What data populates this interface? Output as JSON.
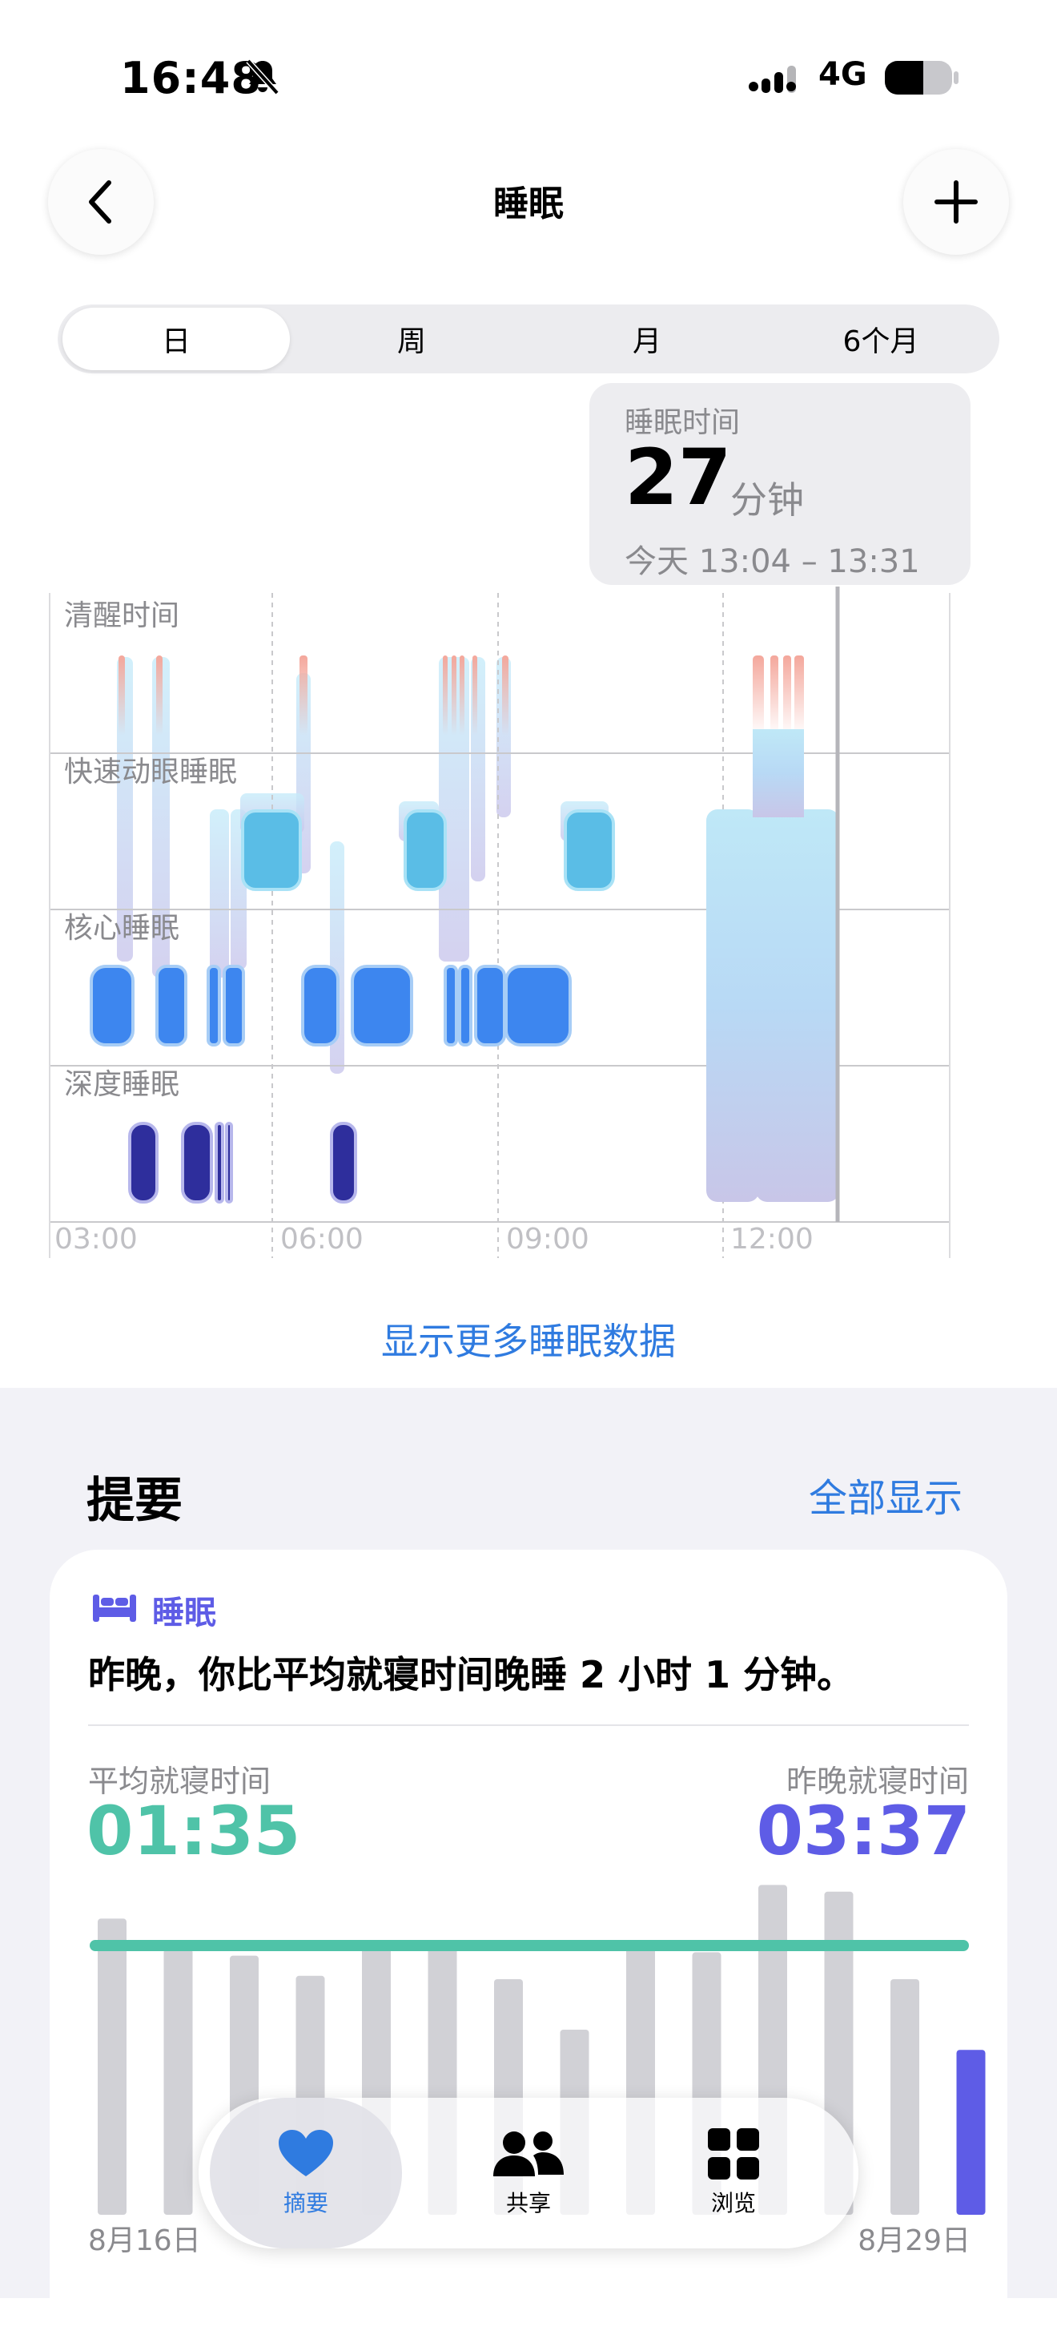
{
  "status_bar": {
    "time": "16:48",
    "network": "4G"
  },
  "nav": {
    "title": "睡眠"
  },
  "segments": [
    {
      "label": "日",
      "active": true
    },
    {
      "label": "周",
      "active": false
    },
    {
      "label": "月",
      "active": false
    },
    {
      "label": "6个月",
      "active": false
    }
  ],
  "popover": {
    "label": "睡眠时间",
    "value": "27",
    "unit": "分钟",
    "range": "今天 13:04 – 13:31"
  },
  "sleep_chart": {
    "stages": [
      "清醒时间",
      "快速动眼睡眠",
      "核心睡眠",
      "深度睡眠"
    ],
    "time_labels": [
      "03:00",
      "06:00",
      "09:00",
      "12:00"
    ],
    "colors": {
      "awake": "#f08a7a",
      "rem": "#5ac8fa",
      "core": "#3b82f6",
      "deep": "#2e2a9a"
    }
  },
  "more_link": "显示更多睡眠数据",
  "summary": {
    "title": "提要",
    "show_all": "全部显示"
  },
  "card": {
    "category": "睡眠",
    "headline": "昨晚，你比平均就寝时间晚睡 2 小时 1 分钟。",
    "avg_label": "平均就寝时间",
    "avg_value": "01:35",
    "last_label": "昨晚就寝时间",
    "last_value": "03:37",
    "start_date": "8月16日",
    "end_date": "8月29日"
  },
  "chart_data": {
    "type": "bar",
    "categories": [
      "8月16日",
      "",
      "",
      "",
      "",
      "",
      "",
      "",
      "",
      "",
      "",
      "",
      "",
      "8月29日"
    ],
    "values": [
      0.88,
      0.79,
      0.77,
      0.71,
      0.8,
      0.81,
      0.7,
      0.55,
      0.8,
      0.78,
      0.98,
      0.96,
      0.7,
      0.49
    ],
    "average": 0.8,
    "colors": {
      "bar": "#d1d1d6",
      "highlight": "#5e5ce6",
      "average_line": "#4fc3a8"
    }
  },
  "tab_bar": [
    {
      "label": "摘要",
      "active": true
    },
    {
      "label": "共享",
      "active": false
    },
    {
      "label": "浏览",
      "active": false
    }
  ]
}
